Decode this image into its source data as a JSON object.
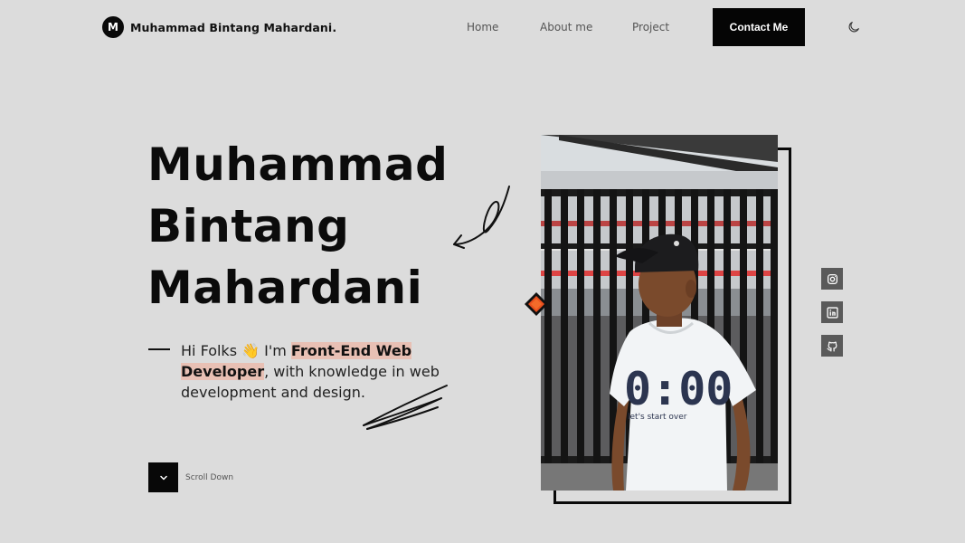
{
  "brand": {
    "logo_letter": "M",
    "name": "Muhammad Bintang Mahardani."
  },
  "nav": {
    "home": "Home",
    "about": "About me",
    "project": "Project",
    "contact": "Contact Me",
    "theme_icon": "moon-icon"
  },
  "hero": {
    "name_line1": "Muhammad",
    "name_line2": "Bintang",
    "name_line3": "Mahardani",
    "intro_greeting": "Hi Folks",
    "intro_emoji": "👋",
    "intro_im": " I'm ",
    "intro_role": "Front-End Web Developer",
    "intro_rest": ", with knowledge in web development and design.",
    "highlight_color": "#e8c0b4"
  },
  "scroll": {
    "label": "Scroll Down",
    "icon": "chevron-down-icon"
  },
  "social": [
    {
      "name": "instagram",
      "icon": "instagram-icon"
    },
    {
      "name": "linkedin",
      "icon": "linkedin-icon"
    },
    {
      "name": "github",
      "icon": "github-icon"
    }
  ],
  "photo": {
    "shirt_text": "0:00",
    "shirt_subtext": "let's start over"
  },
  "colors": {
    "background": "#dcdcdc",
    "primary": "#050505",
    "accent": "#e8501e",
    "social_bg": "#5a5a5a"
  }
}
